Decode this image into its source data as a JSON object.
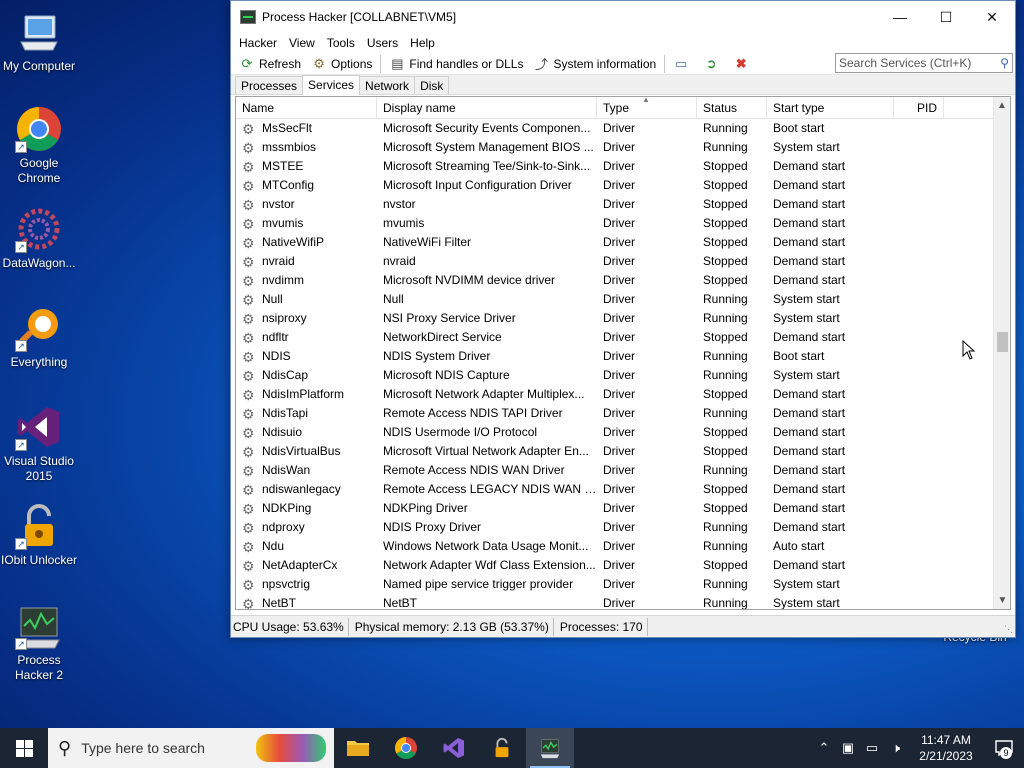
{
  "desktop": {
    "icons": [
      {
        "label": "My Computer",
        "icon": "computer-icon"
      },
      {
        "label": "Google Chrome",
        "icon": "chrome-icon"
      },
      {
        "label": "DataWagon...",
        "icon": "datawagon-icon"
      },
      {
        "label": "Everything",
        "icon": "everything-search-icon"
      },
      {
        "label": "Visual Studio 2015",
        "icon": "visual-studio-icon"
      },
      {
        "label": "IObit Unlocker",
        "icon": "iobit-unlocker-icon"
      },
      {
        "label": "Process Hacker 2",
        "icon": "process-hacker-icon"
      }
    ],
    "recycle_bin": "Recycle Bin"
  },
  "window": {
    "title": "Process Hacker [COLLABNET\\VM5]",
    "menu": [
      "Hacker",
      "View",
      "Tools",
      "Users",
      "Help"
    ],
    "toolbar": {
      "refresh": "Refresh",
      "options": "Options",
      "find": "Find handles or DLLs",
      "sysinfo": "System information"
    },
    "search_placeholder": "Search Services (Ctrl+K)",
    "tabs": [
      "Processes",
      "Services",
      "Network",
      "Disk"
    ],
    "active_tab": "Services",
    "columns": [
      "Name",
      "Display name",
      "Type",
      "Status",
      "Start type",
      "PID"
    ],
    "rows": [
      [
        "MsSecFlt",
        "Microsoft Security Events Componen...",
        "Driver",
        "Running",
        "Boot start"
      ],
      [
        "mssmbios",
        "Microsoft System Management BIOS ...",
        "Driver",
        "Running",
        "System start"
      ],
      [
        "MSTEE",
        "Microsoft Streaming Tee/Sink-to-Sink...",
        "Driver",
        "Stopped",
        "Demand start"
      ],
      [
        "MTConfig",
        "Microsoft Input Configuration Driver",
        "Driver",
        "Stopped",
        "Demand start"
      ],
      [
        "nvstor",
        "nvstor",
        "Driver",
        "Stopped",
        "Demand start"
      ],
      [
        "mvumis",
        "mvumis",
        "Driver",
        "Stopped",
        "Demand start"
      ],
      [
        "NativeWifiP",
        "NativeWiFi Filter",
        "Driver",
        "Stopped",
        "Demand start"
      ],
      [
        "nvraid",
        "nvraid",
        "Driver",
        "Stopped",
        "Demand start"
      ],
      [
        "nvdimm",
        "Microsoft NVDIMM device driver",
        "Driver",
        "Stopped",
        "Demand start"
      ],
      [
        "Null",
        "Null",
        "Driver",
        "Running",
        "System start"
      ],
      [
        "nsiproxy",
        "NSI Proxy Service Driver",
        "Driver",
        "Running",
        "System start"
      ],
      [
        "ndfltr",
        "NetworkDirect Service",
        "Driver",
        "Stopped",
        "Demand start"
      ],
      [
        "NDIS",
        "NDIS System Driver",
        "Driver",
        "Running",
        "Boot start"
      ],
      [
        "NdisCap",
        "Microsoft NDIS Capture",
        "Driver",
        "Running",
        "System start"
      ],
      [
        "NdisImPlatform",
        "Microsoft Network Adapter Multiplex...",
        "Driver",
        "Stopped",
        "Demand start"
      ],
      [
        "NdisTapi",
        "Remote Access NDIS TAPI Driver",
        "Driver",
        "Running",
        "Demand start"
      ],
      [
        "Ndisuio",
        "NDIS Usermode I/O Protocol",
        "Driver",
        "Stopped",
        "Demand start"
      ],
      [
        "NdisVirtualBus",
        "Microsoft Virtual Network Adapter En...",
        "Driver",
        "Stopped",
        "Demand start"
      ],
      [
        "NdisWan",
        "Remote Access NDIS WAN Driver",
        "Driver",
        "Running",
        "Demand start"
      ],
      [
        "ndiswanlegacy",
        "Remote Access LEGACY NDIS WAN D...",
        "Driver",
        "Stopped",
        "Demand start"
      ],
      [
        "NDKPing",
        "NDKPing Driver",
        "Driver",
        "Stopped",
        "Demand start"
      ],
      [
        "ndproxy",
        "NDIS Proxy Driver",
        "Driver",
        "Running",
        "Demand start"
      ],
      [
        "Ndu",
        "Windows Network Data Usage Monit...",
        "Driver",
        "Running",
        "Auto start"
      ],
      [
        "NetAdapterCx",
        "Network Adapter Wdf Class Extension...",
        "Driver",
        "Stopped",
        "Demand start"
      ],
      [
        "npsvctrig",
        "Named pipe service trigger provider",
        "Driver",
        "Running",
        "System start"
      ],
      [
        "NetBT",
        "NetBT",
        "Driver",
        "Running",
        "System start"
      ]
    ],
    "status": {
      "cpu": "CPU Usage: 53.63%",
      "memory": "Physical memory: 2.13 GB (53.37%)",
      "processes": "Processes: 170"
    }
  },
  "taskbar": {
    "search_placeholder": "Type here to search",
    "time": "11:47 AM",
    "date": "2/21/2023",
    "notification_count": "9"
  },
  "colors": {
    "desktop": "#0b5ac4",
    "taskbar": "#1b2533",
    "taskbar_active": "#3b4656"
  }
}
